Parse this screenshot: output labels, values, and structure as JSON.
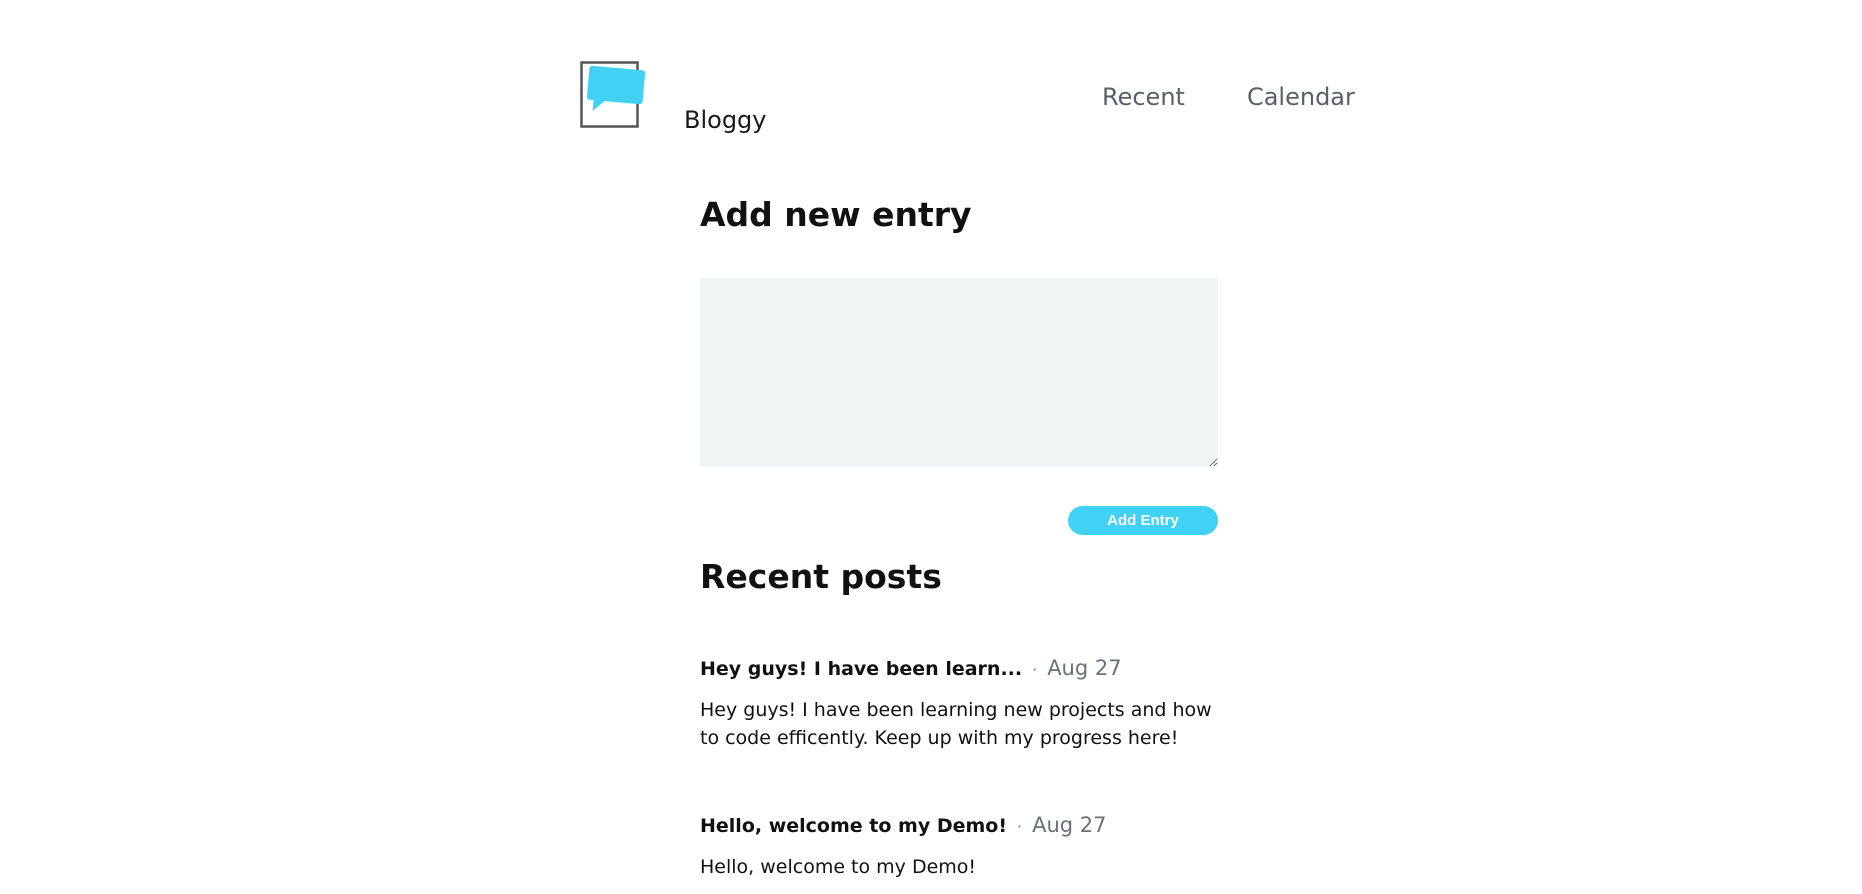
{
  "header": {
    "brand": "Bloggy",
    "nav": [
      "Recent",
      "Calendar"
    ]
  },
  "icons": {
    "logo": "chat-bubble-logo-icon"
  },
  "colors": {
    "accent": "#40d1f5",
    "textarea_bg": "#f1f4f4",
    "nav_text": "#5a6068"
  },
  "add_entry": {
    "title": "Add new entry",
    "textarea_value": "",
    "button_label": "Add Entry"
  },
  "recent": {
    "title": "Recent posts",
    "posts": [
      {
        "title": "Hey guys! I have been learn...",
        "separator": "·",
        "date": "Aug 27",
        "body": "Hey guys! I have been learning new projects and how to code efficently. Keep up with my progress here!"
      },
      {
        "title": "Hello, welcome to my Demo!",
        "separator": "·",
        "date": "Aug 27",
        "body": "Hello, welcome to my Demo!"
      }
    ]
  }
}
